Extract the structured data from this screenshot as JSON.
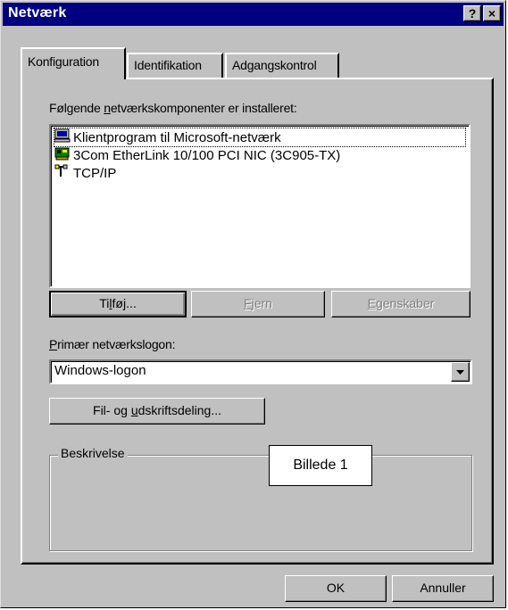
{
  "window": {
    "title": "Netværk",
    "help_button": "?",
    "close_button": "×"
  },
  "tabs": [
    {
      "label": "Konfiguration",
      "active": true
    },
    {
      "label": "Identifikation",
      "active": false
    },
    {
      "label": "Adgangskontrol",
      "active": false
    }
  ],
  "components": {
    "label_pre": "Følgende ",
    "label_accel": "n",
    "label_post": "etværkskomponenter er installeret:",
    "items": [
      {
        "label": "Klientprogram til Microsoft-netværk",
        "icon": "client-network-icon"
      },
      {
        "label": "3Com EtherLink 10/100 PCI NIC (3C905-TX)",
        "icon": "network-card-icon"
      },
      {
        "label": "TCP/IP",
        "icon": "protocol-icon"
      }
    ]
  },
  "buttons": {
    "add_pre": "Ti",
    "add_accel": "l",
    "add_post": "føj...",
    "remove_accel": "F",
    "remove_post": "jern",
    "properties_accel": "E",
    "properties_post": "genskaber",
    "file_sharing_pre": "Fil- og ",
    "file_sharing_accel": "u",
    "file_sharing_post": "dskriftsdeling...",
    "ok": "OK",
    "cancel": "Annuller"
  },
  "logon": {
    "label_accel": "P",
    "label_post": "rimær netværkslogon:",
    "value": "Windows-logon"
  },
  "description": {
    "label": "Beskrivelse"
  },
  "callout": {
    "text": "Billede 1"
  },
  "colors": {
    "titlebar": "#000080",
    "face": "#c0c0c0",
    "disabled_text": "#808080"
  }
}
